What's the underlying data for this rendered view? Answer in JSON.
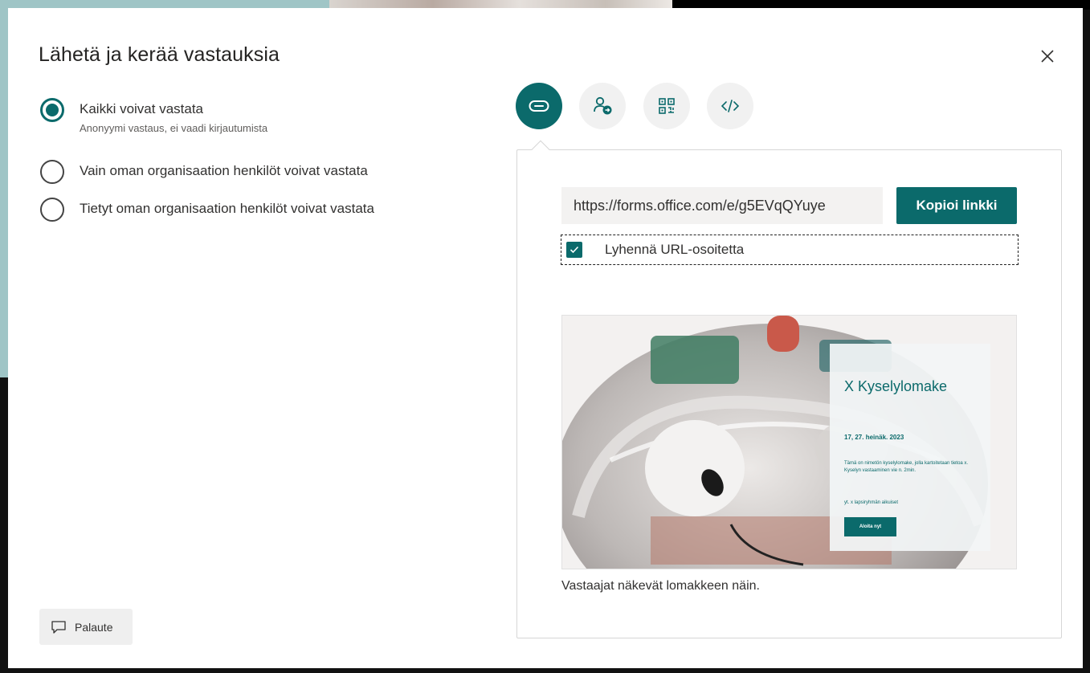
{
  "dialog": {
    "title": "Lähetä ja kerää vastauksia"
  },
  "audience": {
    "options": [
      {
        "label": "Kaikki voivat vastata",
        "sub": "Anonyymi vastaus, ei vaadi kirjautumista",
        "selected": true
      },
      {
        "label": "Vain oman organisaation henkilöt voivat vastata",
        "selected": false
      },
      {
        "label": "Tietyt oman organisaation henkilöt voivat vastata",
        "selected": false
      }
    ]
  },
  "share_tabs": [
    {
      "icon": "link-icon",
      "active": true
    },
    {
      "icon": "invite-people-icon",
      "active": false
    },
    {
      "icon": "qr-code-icon",
      "active": false
    },
    {
      "icon": "embed-code-icon",
      "active": false
    }
  ],
  "link": {
    "url": "https://forms.office.com/e/g5EVqQYuye",
    "copy_label": "Kopioi linkki",
    "shorten_label": "Lyhennä URL-osoitetta",
    "shorten_checked": true
  },
  "preview": {
    "form_title": "X Kyselylomake",
    "date": "17, 27. heinäk. 2023",
    "description": "Tämä on nimetön kyselylomake, jolla kartoitetaan tietoa x. Kyselyn vastaaminen vie n. 2min.",
    "note": "yt. x lapsiryhmän aikuiset",
    "start_label": "Aloita nyt",
    "caption": "Vastaajat näkevät lomakkeen näin."
  },
  "feedback": {
    "label": "Palaute"
  },
  "colors": {
    "accent": "#0b6a6b"
  }
}
